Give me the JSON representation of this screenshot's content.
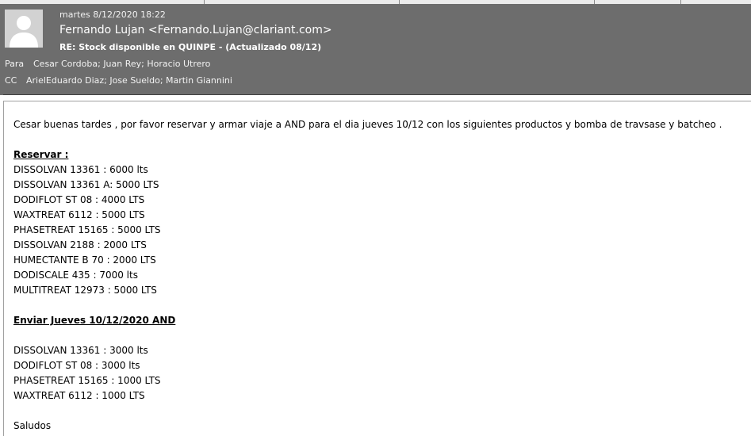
{
  "email": {
    "date": "martes 8/12/2020 18:22",
    "from": "Fernando Lujan <Fernando.Lujan@clariant.com>",
    "subject": "RE: Stock disponible en QUINPE - (Actualizado 08/12)",
    "to_label": "Para",
    "to_value": "Cesar Cordoba; Juan Rey; Horacio Utrero",
    "cc_label": "CC",
    "cc_value": "ArielEduardo Diaz; Jose Sueldo; Martin  Giannini"
  },
  "body": {
    "intro": "Cesar buenas tardes , por favor reservar y armar viaje a AND para el dia jueves 10/12 con los siguientes productos y bomba de travsase y batcheo .",
    "reserve_heading": "Reservar :",
    "reserve_items": [
      "DISSOLVAN 13361 : 6000 lts",
      "DISSOLVAN 13361 A: 5000 LTS",
      "DODIFLOT ST 08 : 4000 LTS",
      "WAXTREAT 6112 : 5000 LTS",
      "PHASETREAT 15165 : 5000 LTS",
      "DISSOLVAN 2188 : 2000 LTS",
      "HUMECTANTE B 70 : 2000 LTS",
      "DODISCALE 435 : 7000 lts",
      "MULTITREAT 12973 : 5000 LTS"
    ],
    "send_heading": "Enviar Jueves 10/12/2020 AND",
    "send_items": [
      "DISSOLVAN 13361 : 3000 lts",
      "DODIFLOT ST 08 : 3000 lts",
      "PHASETREAT 15165 : 1000 LTS",
      "WAXTREAT 6112 : 1000 LTS"
    ],
    "closing": "Saludos"
  },
  "colors": {
    "header_bg": "#6d6d6d",
    "avatar_bg": "#d2d2d2",
    "avatar_fg": "#ffffff"
  }
}
